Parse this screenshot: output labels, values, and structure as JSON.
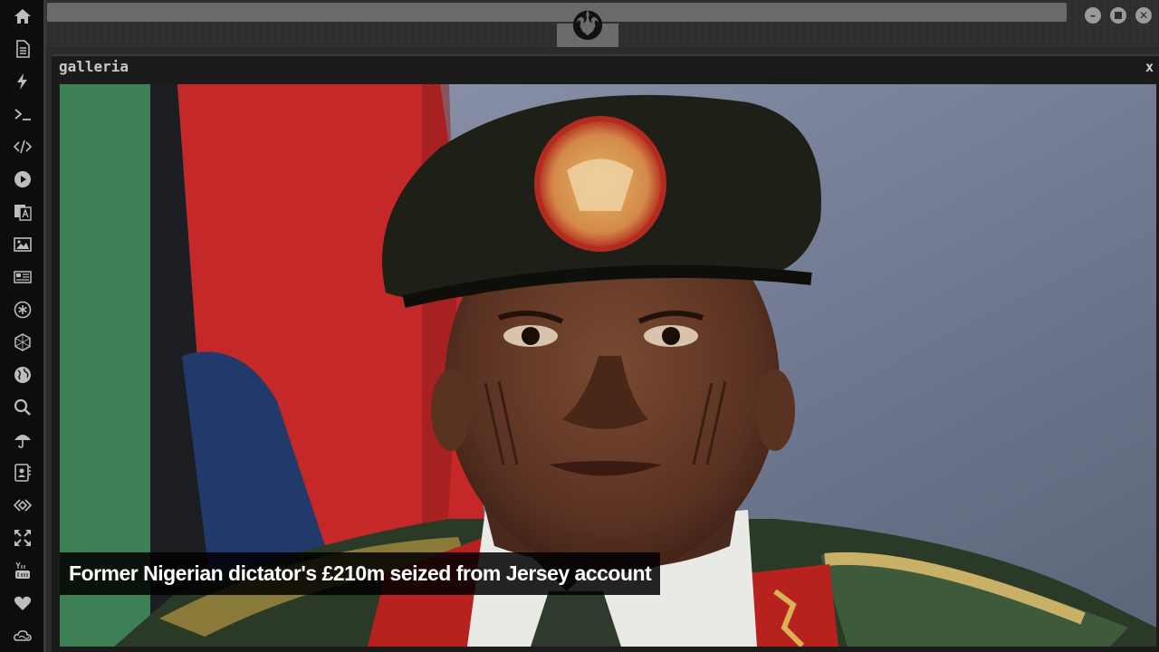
{
  "dock": {
    "items": [
      {
        "name": "home-icon"
      },
      {
        "name": "document-icon"
      },
      {
        "name": "lightning-icon"
      },
      {
        "name": "terminal-icon"
      },
      {
        "name": "code-icon"
      },
      {
        "name": "play-icon"
      },
      {
        "name": "translate-icon"
      },
      {
        "name": "image-icon"
      },
      {
        "name": "newspaper-icon"
      },
      {
        "name": "asterisk-icon"
      },
      {
        "name": "hexagon-icon"
      },
      {
        "name": "globe-icon"
      },
      {
        "name": "search-icon"
      },
      {
        "name": "umbrella-icon"
      },
      {
        "name": "contacts-icon"
      },
      {
        "name": "diamond-code-icon"
      },
      {
        "name": "expand-icon"
      },
      {
        "name": "youtube-icon"
      },
      {
        "name": "heart-icon"
      },
      {
        "name": "cloud-icon"
      }
    ]
  },
  "window": {
    "title": "galleria",
    "close_label": "x"
  },
  "gallery": {
    "caption": "Former Nigerian dictator's £210m seized from Jersey account"
  },
  "colors": {
    "dock_bg": "#0d0d0d",
    "icon": "#bdbdbd",
    "topbar_bg": "#2e2e2e",
    "window_bg": "#1b1b1b"
  }
}
